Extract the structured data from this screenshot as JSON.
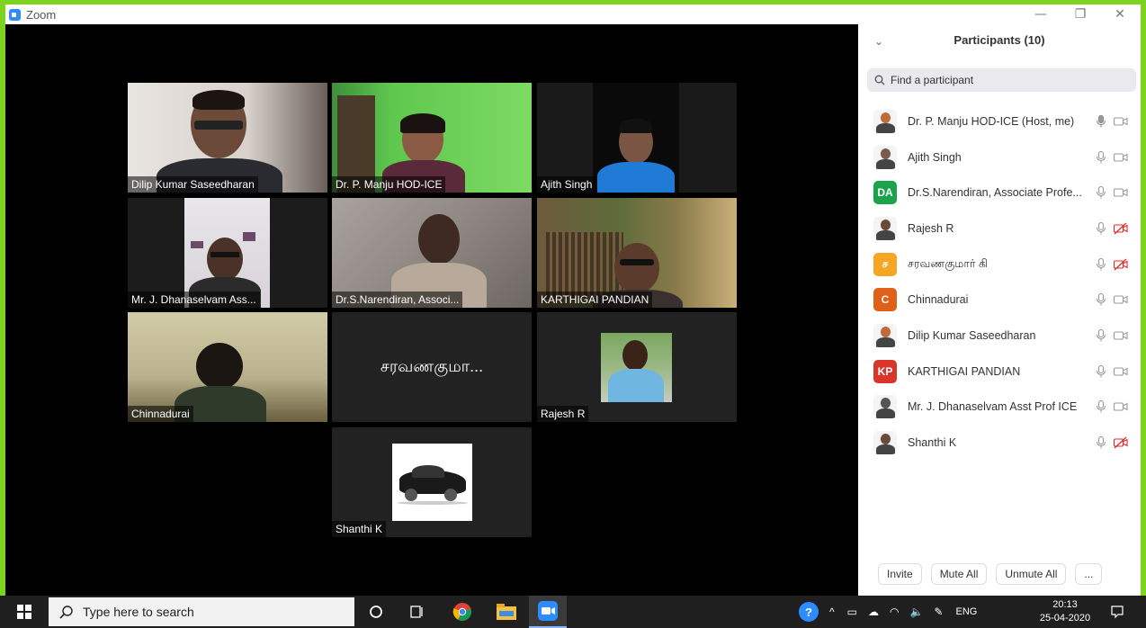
{
  "app": {
    "title": "Zoom"
  },
  "tiles": [
    {
      "name": "Dilip Kumar Saseedharan"
    },
    {
      "name": "Dr. P. Manju HOD-ICE"
    },
    {
      "name": "Ajith Singh"
    },
    {
      "name": "Mr. J. Dhanaselvam Ass..."
    },
    {
      "name": "Dr.S.Narendiran, Associ..."
    },
    {
      "name": "KARTHIGAI PANDIAN"
    },
    {
      "name": "Chinnadurai"
    },
    {
      "name": "சரவணகுமா...",
      "is_name_only": true
    },
    {
      "name": "Rajesh R"
    },
    {
      "name": "Shanthi K"
    }
  ],
  "panel": {
    "title": "Participants (10)",
    "search_placeholder": "Find a participant",
    "participants": [
      {
        "name": "Dr. P. Manju HOD-ICE (Host, me)",
        "avatar": "photo",
        "mic": "active",
        "video": "on"
      },
      {
        "name": "Ajith Singh",
        "avatar": "photo",
        "mic": "on",
        "video": "on"
      },
      {
        "name": "Dr.S.Narendiran, Associate Profe...",
        "avatar_text": "DA",
        "avatar_color": "#1ba34b",
        "mic": "on",
        "video": "on"
      },
      {
        "name": "Rajesh R",
        "avatar": "photo",
        "mic": "on",
        "video": "off"
      },
      {
        "name": "சரவணகுமார் கி",
        "avatar_text": "ச",
        "avatar_color": "#f5a623",
        "mic": "on",
        "video": "off"
      },
      {
        "name": "Chinnadurai",
        "avatar_text": "C",
        "avatar_color": "#e0601a",
        "mic": "on",
        "video": "on"
      },
      {
        "name": "Dilip Kumar Saseedharan",
        "avatar": "photo",
        "mic": "on",
        "video": "on"
      },
      {
        "name": "KARTHIGAI PANDIAN",
        "avatar_text": "KP",
        "avatar_color": "#d9362b",
        "mic": "on",
        "video": "on"
      },
      {
        "name": "Mr. J. Dhanaselvam Asst Prof ICE",
        "avatar": "photo",
        "mic": "on",
        "video": "on"
      },
      {
        "name": "Shanthi K",
        "avatar": "photo",
        "mic": "on",
        "video": "off"
      }
    ],
    "buttons": {
      "invite": "Invite",
      "mute_all": "Mute All",
      "unmute_all": "Unmute All",
      "more": "..."
    }
  },
  "taskbar": {
    "search_placeholder": "Type here to search",
    "language": "ENG",
    "time": "20:13",
    "date": "25-04-2020"
  },
  "colors": {
    "accent_border": "#7ed321",
    "active_speaker": "#e3e67b",
    "video_off": "#e02828"
  }
}
